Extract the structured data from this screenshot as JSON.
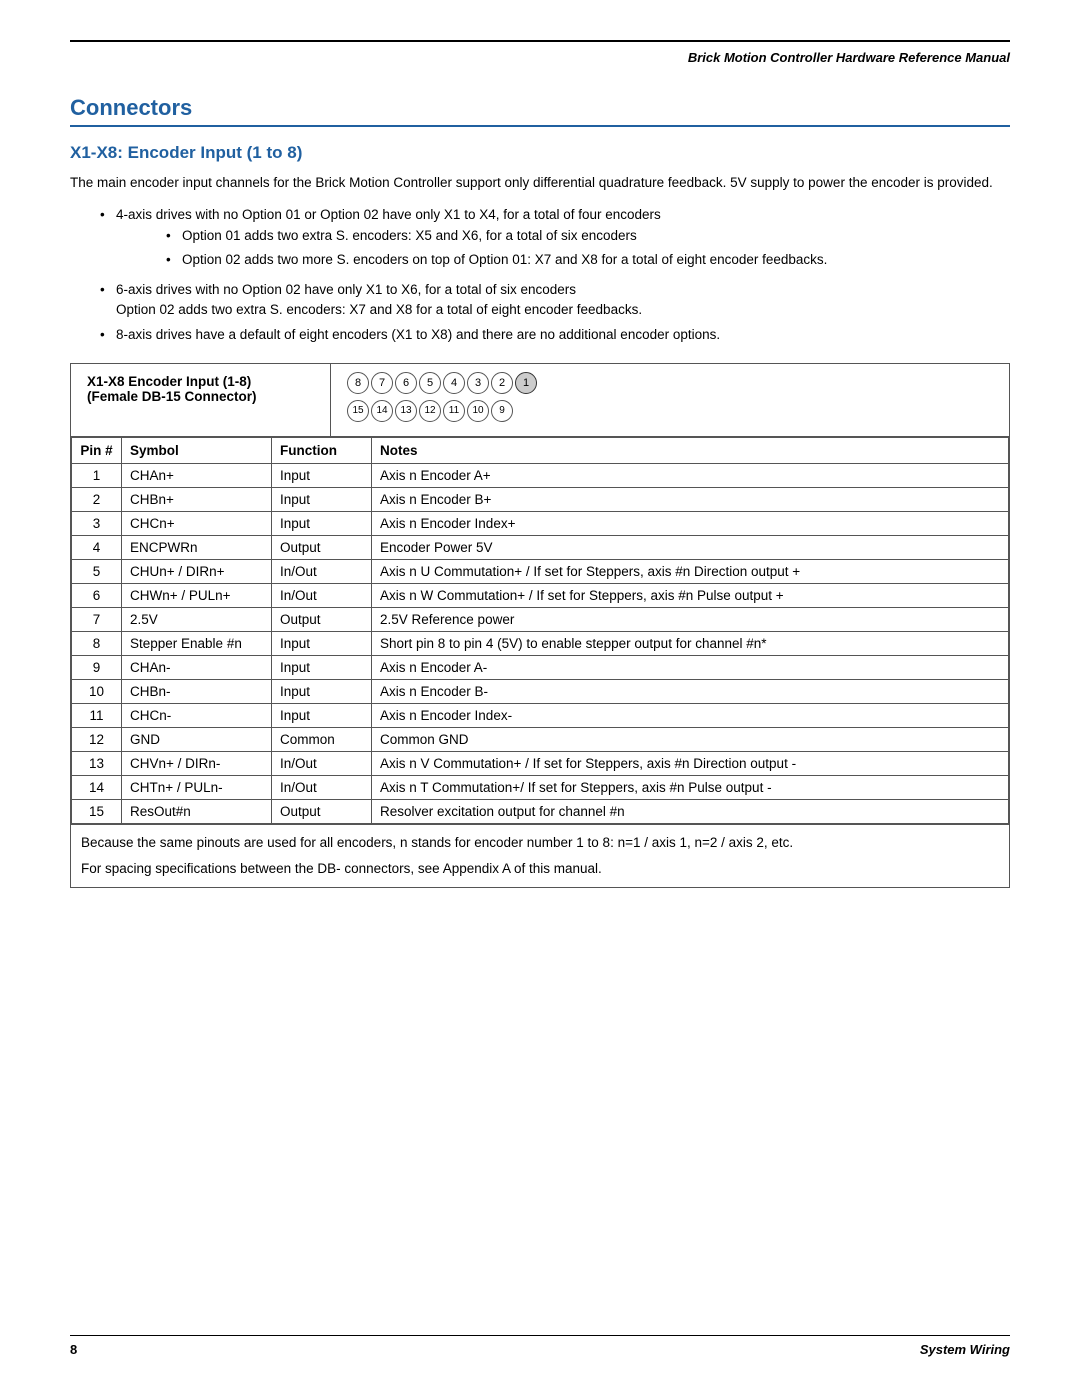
{
  "header": {
    "title": "Brick Motion Controller Hardware Reference Manual"
  },
  "footer": {
    "page_number": "8",
    "section": "System Wiring"
  },
  "section": {
    "title": "Connectors",
    "subsection_title": "X1-X8: Encoder Input (1 to 8)",
    "intro": "The main encoder input channels for the Brick Motion Controller support only differential quadrature feedback.  5V supply to power the encoder is provided.",
    "bullets": [
      {
        "text": "4-axis drives with no Option 01 or Option 02 have only X1 to X4, for a total of four encoders",
        "sub": [
          "Option 01 adds two extra S. encoders: X5 and X6, for a total of six encoders",
          "Option 02 adds two more S. encoders on top of Option 01: X7 and X8 for a total of eight encoder feedbacks."
        ]
      },
      {
        "text": "6-axis drives with no Option 02 have only X1 to X6, for a total of six encoders\nOption 02 adds two extra S. encoders:  X7 and X8 for a total of eight encoder feedbacks.",
        "sub": []
      },
      {
        "text": "8-axis drives have a default of eight encoders (X1 to X8) and there are no additional encoder options.",
        "sub": []
      }
    ],
    "connector_header_left_line1": "X1-X8 Encoder Input (1-8)",
    "connector_header_left_line2": "(Female DB-15 Connector)",
    "pin_rows_top": [
      {
        "label": "8",
        "filled": false
      },
      {
        "label": "7",
        "filled": false
      },
      {
        "label": "6",
        "filled": false
      },
      {
        "label": "5",
        "filled": false
      },
      {
        "label": "4",
        "filled": false
      },
      {
        "label": "3",
        "filled": false
      },
      {
        "label": "2",
        "filled": false
      },
      {
        "label": "1",
        "filled": true
      }
    ],
    "pin_rows_bottom": [
      {
        "label": "15",
        "filled": false
      },
      {
        "label": "14",
        "filled": false
      },
      {
        "label": "13",
        "filled": false
      },
      {
        "label": "12",
        "filled": false
      },
      {
        "label": "11",
        "filled": false
      },
      {
        "label": "10",
        "filled": false
      },
      {
        "label": "9",
        "filled": false
      }
    ],
    "table_headers": [
      "Pin #",
      "Symbol",
      "Function",
      "Notes"
    ],
    "table_rows": [
      {
        "pin": "1",
        "symbol": "CHAn+",
        "function": "Input",
        "notes": "Axis n Encoder A+"
      },
      {
        "pin": "2",
        "symbol": "CHBn+",
        "function": "Input",
        "notes": "Axis n Encoder B+"
      },
      {
        "pin": "3",
        "symbol": "CHCn+",
        "function": "Input",
        "notes": "Axis n Encoder Index+"
      },
      {
        "pin": "4",
        "symbol": "ENCPWRn",
        "function": "Output",
        "notes": "Encoder Power 5V"
      },
      {
        "pin": "5",
        "symbol": "CHUn+ / DIRn+",
        "function": "In/Out",
        "notes": "Axis n U Commutation+ / If set for Steppers, axis #n Direction output +"
      },
      {
        "pin": "6",
        "symbol": "CHWn+ / PULn+",
        "function": "In/Out",
        "notes": "Axis n W Commutation+ / If set for Steppers, axis #n Pulse output +"
      },
      {
        "pin": "7",
        "symbol": "2.5V",
        "function": "Output",
        "notes": "2.5V Reference power"
      },
      {
        "pin": "8",
        "symbol": "Stepper Enable #n",
        "function": "Input",
        "notes": "Short pin 8 to pin 4 (5V) to enable stepper output for channel #n*"
      },
      {
        "pin": "9",
        "symbol": "CHAn-",
        "function": "Input",
        "notes": "Axis n Encoder A-"
      },
      {
        "pin": "10",
        "symbol": "CHBn-",
        "function": "Input",
        "notes": "Axis n Encoder B-"
      },
      {
        "pin": "11",
        "symbol": "CHCn-",
        "function": "Input",
        "notes": "Axis n Encoder Index-"
      },
      {
        "pin": "12",
        "symbol": "GND",
        "function": "Common",
        "notes": "Common GND"
      },
      {
        "pin": "13",
        "symbol": "CHVn+ / DIRn-",
        "function": "In/Out",
        "notes": "Axis n V Commutation+ / If set for Steppers, axis #n Direction output -"
      },
      {
        "pin": "14",
        "symbol": "CHTn+ / PULn-",
        "function": "In/Out",
        "notes": "Axis n T Commutation+/ If set for Steppers, axis #n Pulse output -"
      },
      {
        "pin": "15",
        "symbol": "ResOut#n",
        "function": "Output",
        "notes": "Resolver excitation output for channel #n"
      }
    ],
    "footnote1": "Because the same pinouts are used for all encoders, n stands for encoder number 1 to 8: n=1 / axis 1, n=2 / axis 2, etc.",
    "footnote2": "For spacing specifications between the DB- connectors, see Appendix A of this manual."
  }
}
